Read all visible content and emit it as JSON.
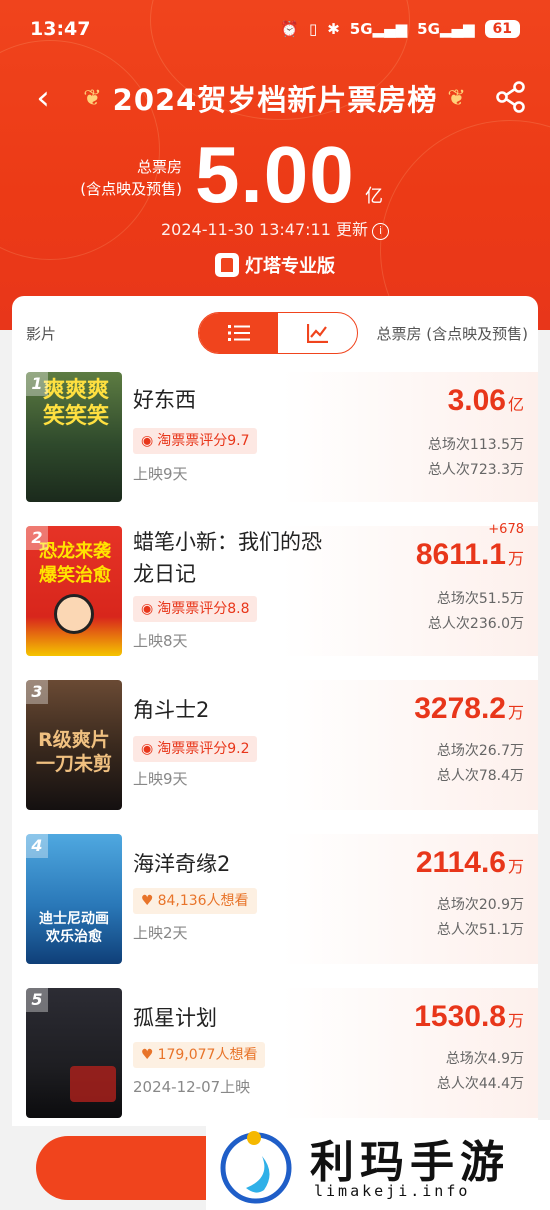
{
  "status_bar": {
    "time": "13:47",
    "signal1": "5G",
    "signal2": "5G",
    "battery": "61"
  },
  "header": {
    "title": "2024贺岁档新片票房榜",
    "total_label_line1": "总票房",
    "total_label_line2": "(含点映及预售)",
    "total_value": "5.00",
    "total_unit": "亿",
    "updated": "2024-11-30 13:47:11 更新",
    "brand": "灯塔专业版",
    "accent_color": "#f0441d"
  },
  "list_header": {
    "left_label": "影片",
    "right_label": "总票房 (含点映及预售)",
    "view_toggle": [
      "list-icon",
      "chart-icon"
    ],
    "active_view": "list"
  },
  "movies": [
    {
      "rank": "1",
      "name_line1": "好东西",
      "name_line2": "",
      "badge": "淘票票评分9.7",
      "badge_type": "rate",
      "released": "上映9天",
      "box_value": "3.06",
      "box_unit": "亿",
      "delta": "",
      "screenings": "总场次113.5万",
      "admissions": "总人次723.3万",
      "poster_text": "爽爽爽\n笑笑笑",
      "poster_color": "#3a5a3a"
    },
    {
      "rank": "2",
      "name_line1": "蜡笔小新：我们的恐",
      "name_line2": "龙日记",
      "badge": "淘票票评分8.8",
      "badge_type": "rate",
      "released": "上映8天",
      "box_value": "8611.1",
      "box_unit": "万",
      "delta": "+678",
      "screenings": "总场次51.5万",
      "admissions": "总人次236.0万",
      "poster_text": "恐龙来袭\n爆笑治愈",
      "poster_color": "#e02a20"
    },
    {
      "rank": "3",
      "name_line1": "角斗士2",
      "name_line2": "",
      "badge": "淘票票评分9.2",
      "badge_type": "rate",
      "released": "上映9天",
      "box_value": "3278.2",
      "box_unit": "万",
      "delta": "",
      "screenings": "总场次26.7万",
      "admissions": "总人次78.4万",
      "poster_text": "R级爽片\n一刀未剪",
      "poster_color": "#3b2a1e"
    },
    {
      "rank": "4",
      "name_line1": "海洋奇缘2",
      "name_line2": "",
      "badge": "84,136人想看",
      "badge_type": "want",
      "released": "上映2天",
      "box_value": "2114.6",
      "box_unit": "万",
      "delta": "",
      "screenings": "总场次20.9万",
      "admissions": "总人次51.1万",
      "poster_text": "迪士尼动画\n欢乐治愈",
      "poster_color": "#2a78b8"
    },
    {
      "rank": "5",
      "name_line1": "孤星计划",
      "name_line2": "",
      "badge": "179,077人想看",
      "badge_type": "want",
      "released": "2024-12-07上映",
      "box_value": "1530.8",
      "box_unit": "万",
      "delta": "",
      "screenings": "总场次4.9万",
      "admissions": "总人次44.4万",
      "poster_text": "",
      "poster_color": "#1e1e22"
    }
  ],
  "watermark": {
    "name": "利玛手游",
    "url": "limakeji.info"
  }
}
